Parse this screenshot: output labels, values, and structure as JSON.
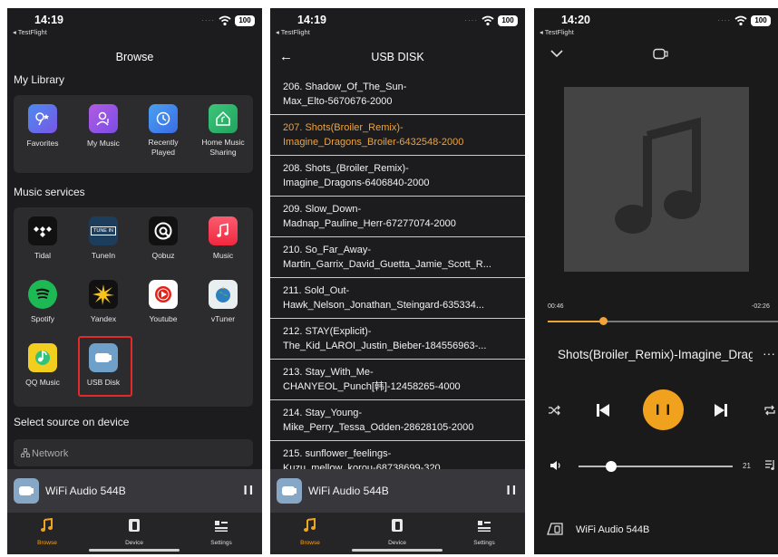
{
  "status": {
    "left_time": "14:19",
    "right_time": "14:20",
    "back_app": "◂ TestFlight",
    "battery": "100"
  },
  "browse": {
    "title": "Browse",
    "my_library_label": "My Library",
    "library_items": [
      {
        "label": "Favorites",
        "icon": "favorites-icon"
      },
      {
        "label": "My Music",
        "icon": "user-icon"
      },
      {
        "label": "Recently\nPlayed",
        "icon": "clock-icon"
      },
      {
        "label": "Home Music\nSharing",
        "icon": "home-icon"
      }
    ],
    "music_services_label": "Music services",
    "services": [
      {
        "label": "Tidal",
        "icon": "tidal-icon"
      },
      {
        "label": "TuneIn",
        "icon": "tunein-icon"
      },
      {
        "label": "Qobuz",
        "icon": "qobuz-icon"
      },
      {
        "label": "Music",
        "icon": "apple-music-icon"
      },
      {
        "label": "Spotify",
        "icon": "spotify-icon"
      },
      {
        "label": "Yandex",
        "icon": "yandex-icon"
      },
      {
        "label": "Youtube",
        "icon": "youtube-icon"
      },
      {
        "label": "vTuner",
        "icon": "vtuner-icon"
      },
      {
        "label": "QQ Music",
        "icon": "qq-music-icon"
      },
      {
        "label": "USB Disk",
        "icon": "usb-disk-icon"
      }
    ],
    "select_source_label": "Select source on device",
    "network_label": "Network",
    "tunein_badge": "TUNE IN"
  },
  "usb": {
    "title": "USB DISK",
    "tracks": [
      {
        "line1": "206. Shadow_Of_The_Sun-",
        "line2": "Max_Elto-5670676-2000",
        "active": false
      },
      {
        "line1": "207. Shots(Broiler_Remix)-",
        "line2": "Imagine_Dragons_Broiler-6432548-2000",
        "active": true
      },
      {
        "line1": "208. Shots_(Broiler_Remix)-",
        "line2": "Imagine_Dragons-6406840-2000",
        "active": false
      },
      {
        "line1": "209. Slow_Down-",
        "line2": "Madnap_Pauline_Herr-67277074-2000",
        "active": false
      },
      {
        "line1": "210. So_Far_Away-",
        "line2": "Martin_Garrix_David_Guetta_Jamie_Scott_R...",
        "active": false
      },
      {
        "line1": "211. Sold_Out-",
        "line2": "Hawk_Nelson_Jonathan_Steingard-635334...",
        "active": false
      },
      {
        "line1": "212. STAY(Explicit)-",
        "line2": "The_Kid_LAROI_Justin_Bieber-184556963-...",
        "active": false
      },
      {
        "line1": "213. Stay_With_Me-",
        "line2": "CHANYEOL_Punch[韩]-12458265-4000",
        "active": false
      },
      {
        "line1": "214. Stay_Young-",
        "line2": "Mike_Perry_Tessa_Odden-28628105-2000",
        "active": false
      },
      {
        "line1": "215. sunflower_feelings-",
        "line2": "Kuzu_mellow_korou-68738699-320",
        "active": false
      }
    ]
  },
  "player_bar": {
    "device_name": "WiFi Audio 544B",
    "pause_label": "I I"
  },
  "tabs": [
    {
      "label": "Browse",
      "icon": "music-note-icon",
      "active": true
    },
    {
      "label": "Device",
      "icon": "speaker-icon",
      "active": false
    },
    {
      "label": "Settings",
      "icon": "settings-icon",
      "active": false
    }
  ],
  "now_playing": {
    "elapsed": "00:46",
    "remaining": "-02:26",
    "progress_fraction": 0.24,
    "title": "Shots(Broiler_Remix)-Imagine_Dragons_Broiler",
    "more": "···",
    "volume": "21",
    "volume_fraction": 0.21,
    "device_name": "WiFi Audio 544B",
    "pause_label": "I I"
  },
  "colors": {
    "accent": "#f0a21f",
    "selection_border": "#e32a2a",
    "background": "#1c1c1e",
    "panel": "#2c2c2e"
  }
}
